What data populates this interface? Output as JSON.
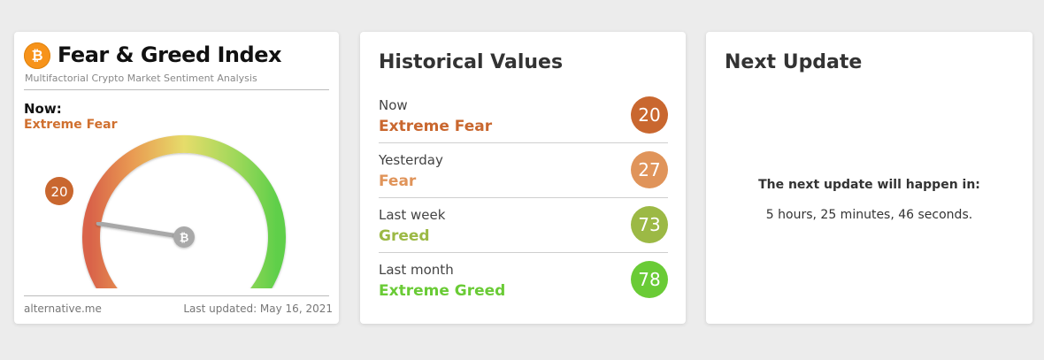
{
  "fgi_card": {
    "logo_symbol": "₿",
    "title": "Fear & Greed Index",
    "subtitle": "Multifactorial Crypto Market Sentiment Analysis",
    "now_label": "Now:",
    "now_classification": "Extreme Fear",
    "value": "20",
    "value_fraction": 0.2,
    "needle_symbol": "₿",
    "footer_site": "alternative.me",
    "footer_updated": "Last updated: May 16, 2021",
    "colors": {
      "fear": "#d0702f",
      "mid": "#e6dc58",
      "greed": "#5fd04a",
      "bitcoin": "#f7931a"
    }
  },
  "historical": {
    "title": "Historical Values",
    "rows": [
      {
        "label": "Now",
        "classification": "Extreme Fear",
        "value": "20",
        "color": "#c9672f"
      },
      {
        "label": "Yesterday",
        "classification": "Fear",
        "value": "27",
        "color": "#e0945a"
      },
      {
        "label": "Last week",
        "classification": "Greed",
        "value": "73",
        "color": "#9cb945"
      },
      {
        "label": "Last month",
        "classification": "Extreme Greed",
        "value": "78",
        "color": "#6acb36"
      }
    ]
  },
  "next_update": {
    "title": "Next Update",
    "message": "The next update will happen in:",
    "countdown": "5 hours, 25 minutes, 46 seconds."
  }
}
